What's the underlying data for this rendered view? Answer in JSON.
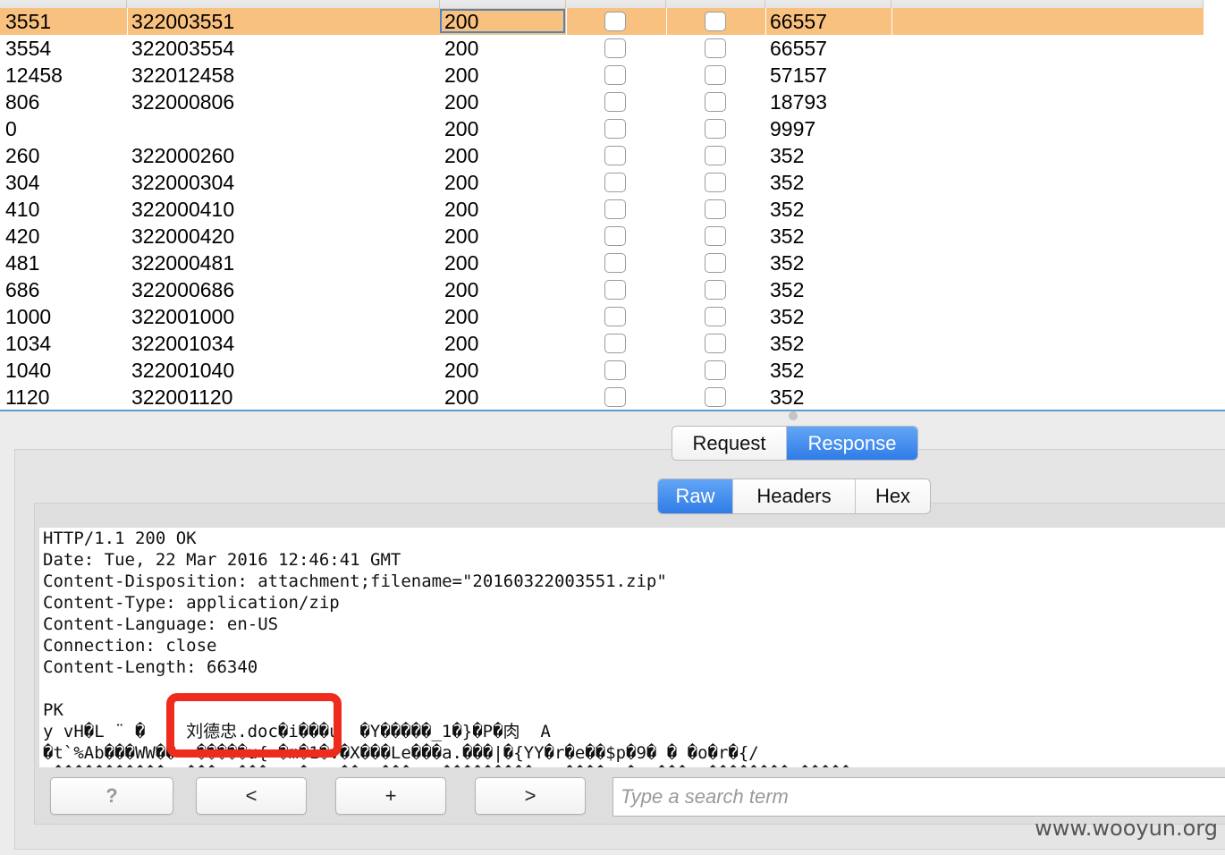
{
  "table": {
    "rows": [
      {
        "request": "3551",
        "payload": "322003551",
        "status": "200",
        "length": "66557",
        "selected": true
      },
      {
        "request": "3554",
        "payload": "322003554",
        "status": "200",
        "length": "66557"
      },
      {
        "request": "12458",
        "payload": "322012458",
        "status": "200",
        "length": "57157"
      },
      {
        "request": "806",
        "payload": "322000806",
        "status": "200",
        "length": "18793"
      },
      {
        "request": "0",
        "payload": "",
        "status": "200",
        "length": "9997"
      },
      {
        "request": "260",
        "payload": "322000260",
        "status": "200",
        "length": "352"
      },
      {
        "request": "304",
        "payload": "322000304",
        "status": "200",
        "length": "352"
      },
      {
        "request": "410",
        "payload": "322000410",
        "status": "200",
        "length": "352"
      },
      {
        "request": "420",
        "payload": "322000420",
        "status": "200",
        "length": "352"
      },
      {
        "request": "481",
        "payload": "322000481",
        "status": "200",
        "length": "352"
      },
      {
        "request": "686",
        "payload": "322000686",
        "status": "200",
        "length": "352"
      },
      {
        "request": "1000",
        "payload": "322001000",
        "status": "200",
        "length": "352"
      },
      {
        "request": "1034",
        "payload": "322001034",
        "status": "200",
        "length": "352"
      },
      {
        "request": "1040",
        "payload": "322001040",
        "status": "200",
        "length": "352"
      },
      {
        "request": "1120",
        "payload": "322001120",
        "status": "200",
        "length": "352"
      }
    ]
  },
  "tabs": {
    "main": [
      {
        "label": "Request",
        "active": false
      },
      {
        "label": "Response",
        "active": true
      }
    ],
    "view": [
      {
        "label": "Raw",
        "active": true
      },
      {
        "label": "Headers",
        "active": false
      },
      {
        "label": "Hex",
        "active": false
      }
    ]
  },
  "response": {
    "lines": [
      "HTTP/1.1 200 OK",
      "Date: Tue, 22 Mar 2016 12:46:41 GMT",
      "Content-Disposition: attachment;filename=\"20160322003551.zip\"",
      "Content-Type: application/zip",
      "Content-Language: en-US",
      "Connection: close",
      "Content-Length: 66340",
      "",
      "PK",
      "y vH�L ¨ �    刘德忠.doc�i���u  �Y�����_1�}�P�肉  A",
      "�t`%Ab���WW��  �����u{ �m�1�v�X���Le���a.���|�{YY�r�e��$p�9� � �o�r�{/",
      "_�����������  ���  ���T  �X  ��/ ���H  ���������   ����  �  ���  ��������/�����"
    ]
  },
  "toolbar": {
    "help_label": "?",
    "prev_label": "<",
    "add_label": "+",
    "next_label": ">",
    "search_placeholder": "Type a search term"
  },
  "watermark": "www.wooyun.org",
  "colors": {
    "selected_row": "#f9c17f",
    "active_tab": "#2f7ce8",
    "highlight": "#ee2b1c"
  }
}
